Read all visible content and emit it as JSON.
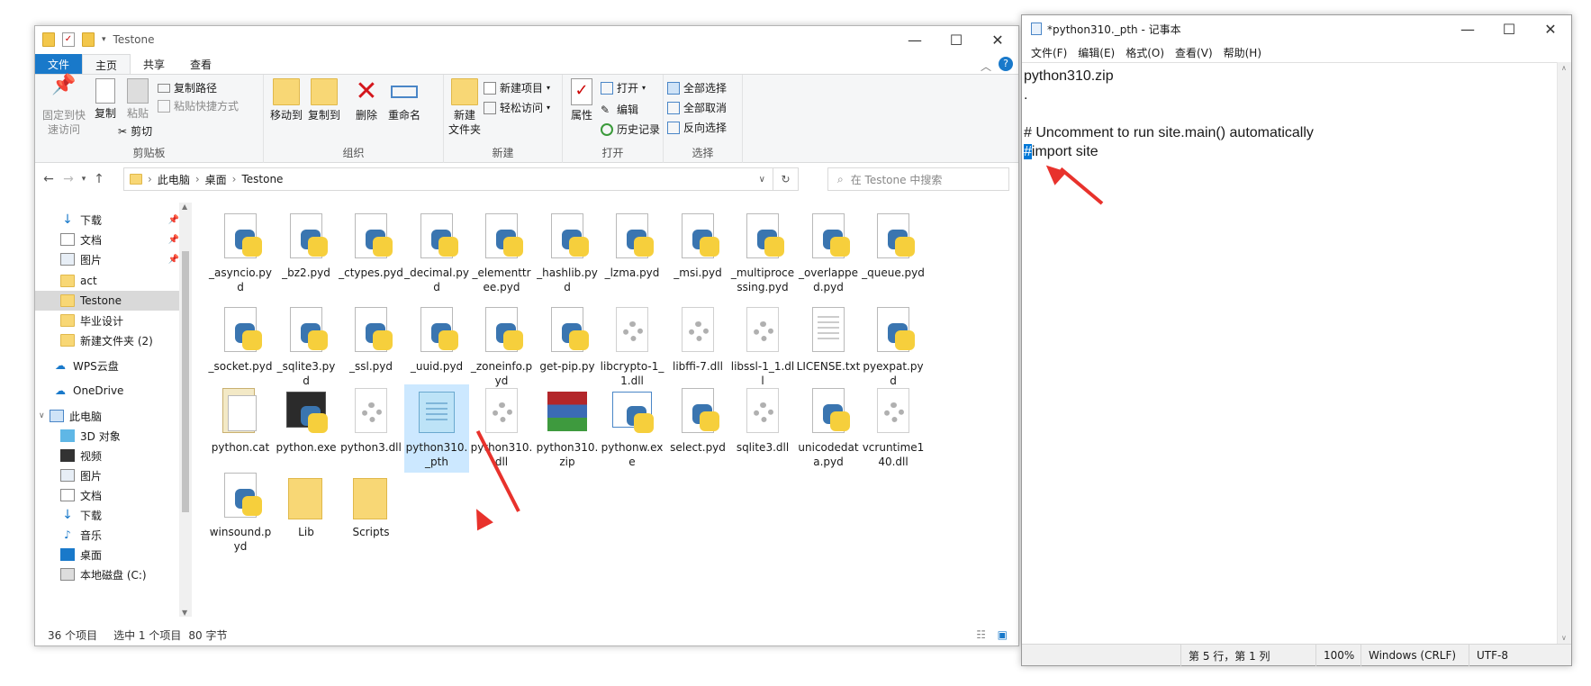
{
  "explorer": {
    "title": "Testone",
    "ribbon_tabs": [
      "文件",
      "主页",
      "共享",
      "查看"
    ],
    "clipboard": {
      "pin_quick": "固定到快\n速访问",
      "copy": "复制",
      "paste": "粘贴",
      "copy_path": "复制路径",
      "paste_shortcut": "粘贴快捷方式",
      "cut": "剪切",
      "group": "剪贴板"
    },
    "organize": {
      "move_to": "移动到",
      "copy_to": "复制到",
      "delete": "删除",
      "rename": "重命名",
      "group": "组织"
    },
    "new": {
      "new_folder": "新建\n文件夹",
      "new_item": "新建项目",
      "easy_access": "轻松访问",
      "group": "新建"
    },
    "open": {
      "properties": "属性",
      "open": "打开",
      "edit": "编辑",
      "history": "历史记录",
      "group": "打开"
    },
    "select": {
      "select_all": "全部选择",
      "select_none": "全部取消",
      "invert": "反向选择",
      "group": "选择"
    },
    "breadcrumb": [
      "此电脑",
      "桌面",
      "Testone"
    ],
    "search_placeholder": "在 Testone 中搜索",
    "nav_items": [
      {
        "label": "下载",
        "pinned": true
      },
      {
        "label": "文档",
        "pinned": true
      },
      {
        "label": "图片",
        "pinned": true
      },
      {
        "label": "act"
      },
      {
        "label": "Testone",
        "selected": true
      },
      {
        "label": "毕业设计"
      },
      {
        "label": "新建文件夹 (2)"
      },
      {
        "label": "WPS云盘"
      },
      {
        "label": "OneDrive"
      },
      {
        "label": "此电脑"
      },
      {
        "label": "3D 对象"
      },
      {
        "label": "视频"
      },
      {
        "label": "图片"
      },
      {
        "label": "文档"
      },
      {
        "label": "下载"
      },
      {
        "label": "音乐"
      },
      {
        "label": "桌面"
      },
      {
        "label": "本地磁盘 (C:)"
      }
    ],
    "files": [
      {
        "name": "_asyncio.pyd",
        "type": "pyd"
      },
      {
        "name": "_bz2.pyd",
        "type": "pyd"
      },
      {
        "name": "_ctypes.pyd",
        "type": "pyd"
      },
      {
        "name": "_decimal.pyd",
        "type": "pyd"
      },
      {
        "name": "_elementtree.pyd",
        "type": "pyd"
      },
      {
        "name": "_hashlib.pyd",
        "type": "pyd"
      },
      {
        "name": "_lzma.pyd",
        "type": "pyd"
      },
      {
        "name": "_msi.pyd",
        "type": "pyd"
      },
      {
        "name": "_multiprocessing.pyd",
        "type": "pyd"
      },
      {
        "name": "_overlapped.pyd",
        "type": "pyd"
      },
      {
        "name": "_queue.pyd",
        "type": "pyd"
      },
      {
        "name": "_socket.pyd",
        "type": "pyd"
      },
      {
        "name": "_sqlite3.pyd",
        "type": "pyd"
      },
      {
        "name": "_ssl.pyd",
        "type": "pyd"
      },
      {
        "name": "_uuid.pyd",
        "type": "pyd"
      },
      {
        "name": "_zoneinfo.pyd",
        "type": "pyd"
      },
      {
        "name": "get-pip.py",
        "type": "py"
      },
      {
        "name": "libcrypto-1_1.dll",
        "type": "dll"
      },
      {
        "name": "libffi-7.dll",
        "type": "dll"
      },
      {
        "name": "libssl-1_1.dll",
        "type": "dll"
      },
      {
        "name": "LICENSE.txt",
        "type": "txt"
      },
      {
        "name": "pyexpat.pyd",
        "type": "pyd"
      },
      {
        "name": "python.cat",
        "type": "cat"
      },
      {
        "name": "python.exe",
        "type": "exe"
      },
      {
        "name": "python3.dll",
        "type": "dll"
      },
      {
        "name": "python310._pth",
        "type": "pth",
        "selected": true
      },
      {
        "name": "python310.dll",
        "type": "dll"
      },
      {
        "name": "python310.zip",
        "type": "zip"
      },
      {
        "name": "pythonw.exe",
        "type": "exew"
      },
      {
        "name": "select.pyd",
        "type": "pyd"
      },
      {
        "name": "sqlite3.dll",
        "type": "dll"
      },
      {
        "name": "unicodedata.pyd",
        "type": "pyd"
      },
      {
        "name": "vcruntime140.dll",
        "type": "dll"
      },
      {
        "name": "winsound.pyd",
        "type": "pyd"
      },
      {
        "name": "Lib",
        "type": "folder"
      },
      {
        "name": "Scripts",
        "type": "folder"
      }
    ],
    "status": {
      "count": "36 个项目",
      "selected": "选中 1 个项目",
      "size": "80 字节"
    }
  },
  "notepad": {
    "title": "*python310._pth - 记事本",
    "menu": [
      "文件(F)",
      "编辑(E)",
      "格式(O)",
      "查看(V)",
      "帮助(H)"
    ],
    "lines": [
      "python310.zip",
      ".",
      "",
      "# Uncomment to run site.main() automatically"
    ],
    "line5_hash": "#",
    "line5_rest": "import site",
    "status": {
      "position": "第 5 行，第 1 列",
      "zoom": "100%",
      "eol": "Windows (CRLF)",
      "encoding": "UTF-8"
    }
  },
  "colors": {
    "accent": "#1979ca",
    "selection": "#cce8ff",
    "annotation_arrow": "#e8322c",
    "text_highlight": "#0078d7"
  }
}
